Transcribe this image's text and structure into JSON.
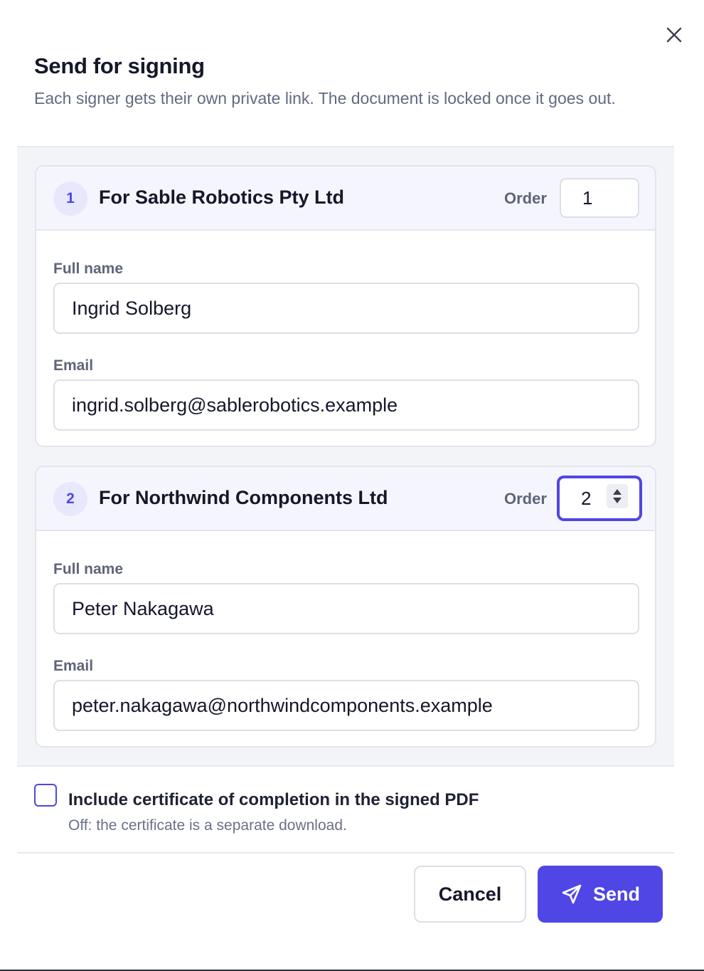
{
  "dialog": {
    "title": "Send for signing",
    "subtitle": "Each signer gets their own private link. The document is locked once it goes out."
  },
  "signers": [
    {
      "number": "1",
      "title": "For Sable Robotics Pty Ltd",
      "order_label": "Order",
      "order_value": "1",
      "full_name_label": "Full name",
      "full_name": "Ingrid Solberg",
      "email_label": "Email",
      "email": "ingrid.solberg@sablerobotics.example"
    },
    {
      "number": "2",
      "title": "For Northwind Components Ltd",
      "order_label": "Order",
      "order_value": "2",
      "full_name_label": "Full name",
      "full_name": "Peter Nakagawa",
      "email_label": "Email",
      "email": "peter.nakagawa@northwindcomponents.example"
    }
  ],
  "certificate": {
    "label": "Include certificate of completion in the signed PDF",
    "help": "Off: the certificate is a separate download.",
    "checked": false
  },
  "actions": {
    "cancel_label": "Cancel",
    "send_label": "Send"
  },
  "colors": {
    "accent": "#4f46e5",
    "muted_text": "#636a80",
    "border": "#dcdfe7"
  },
  "icons": {
    "close": "close-icon",
    "send": "send-icon",
    "spinner": "spinner-icon"
  }
}
